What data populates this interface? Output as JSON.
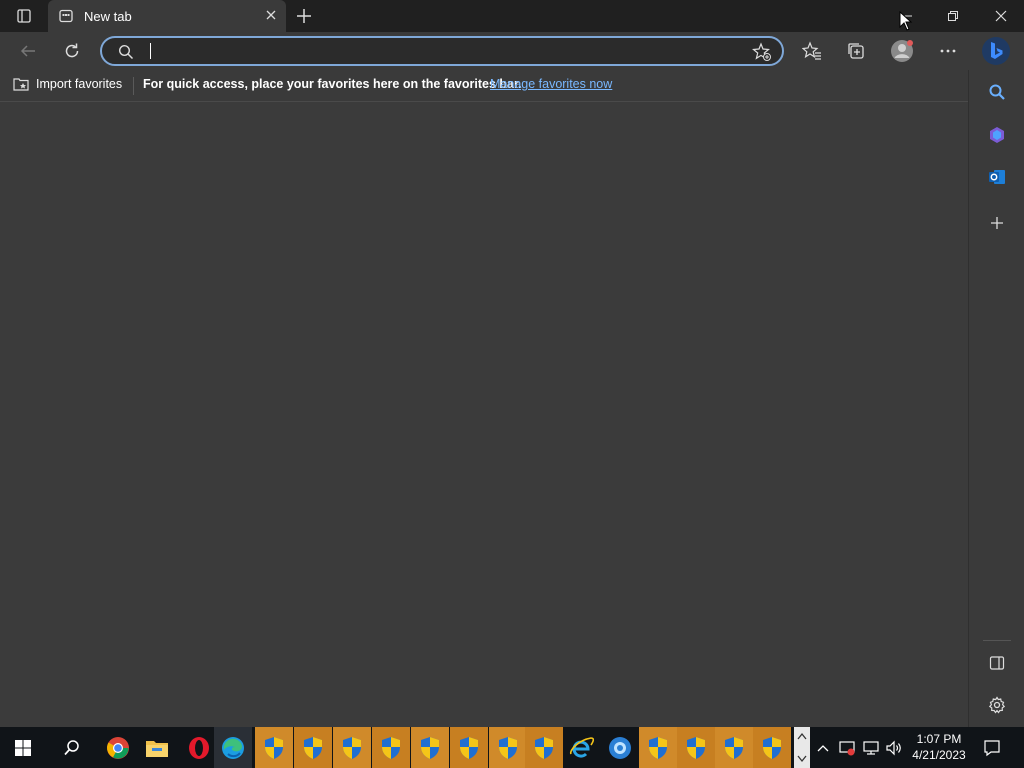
{
  "tab": {
    "title": "New tab"
  },
  "address_bar": {
    "value": "",
    "placeholder": ""
  },
  "favorites_bar": {
    "import_label": "Import favorites",
    "message": "For quick access, place your favorites here on the favorites bar.",
    "manage_link": "Manage favorites now"
  },
  "taskbar": {
    "time": "1:07 PM",
    "date": "4/21/2023"
  },
  "colors": {
    "accent": "#7fa8d8",
    "link": "#79b8ff",
    "content_bg": "#3b3b3b",
    "taskbar_highlight": "#d08a2a"
  }
}
